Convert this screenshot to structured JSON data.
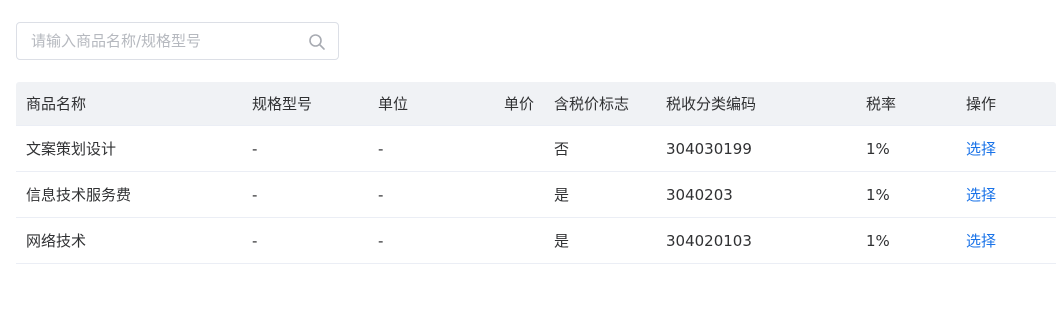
{
  "search": {
    "placeholder": "请输入商品名称/规格型号",
    "value": ""
  },
  "table": {
    "columns": {
      "name": "商品名称",
      "spec": "规格型号",
      "unit": "单位",
      "price": "单价",
      "tax_included": "含税价标志",
      "tax_code": "税收分类编码",
      "tax_rate": "税率",
      "action": "操作"
    },
    "rows": [
      {
        "name": "文案策划设计",
        "spec": "-",
        "unit": "-",
        "price": "",
        "tax_included": "否",
        "tax_code": "304030199",
        "tax_rate": "1%",
        "action": "选择"
      },
      {
        "name": "信息技术服务费",
        "spec": "-",
        "unit": "-",
        "price": "",
        "tax_included": "是",
        "tax_code": "3040203",
        "tax_rate": "1%",
        "action": "选择"
      },
      {
        "name": "网络技术",
        "spec": "-",
        "unit": "-",
        "price": "",
        "tax_included": "是",
        "tax_code": "304020103",
        "tax_rate": "1%",
        "action": "选择"
      }
    ]
  },
  "colors": {
    "link": "#1a73e8",
    "header_bg": "#f0f2f5",
    "border": "#ebeef5"
  }
}
